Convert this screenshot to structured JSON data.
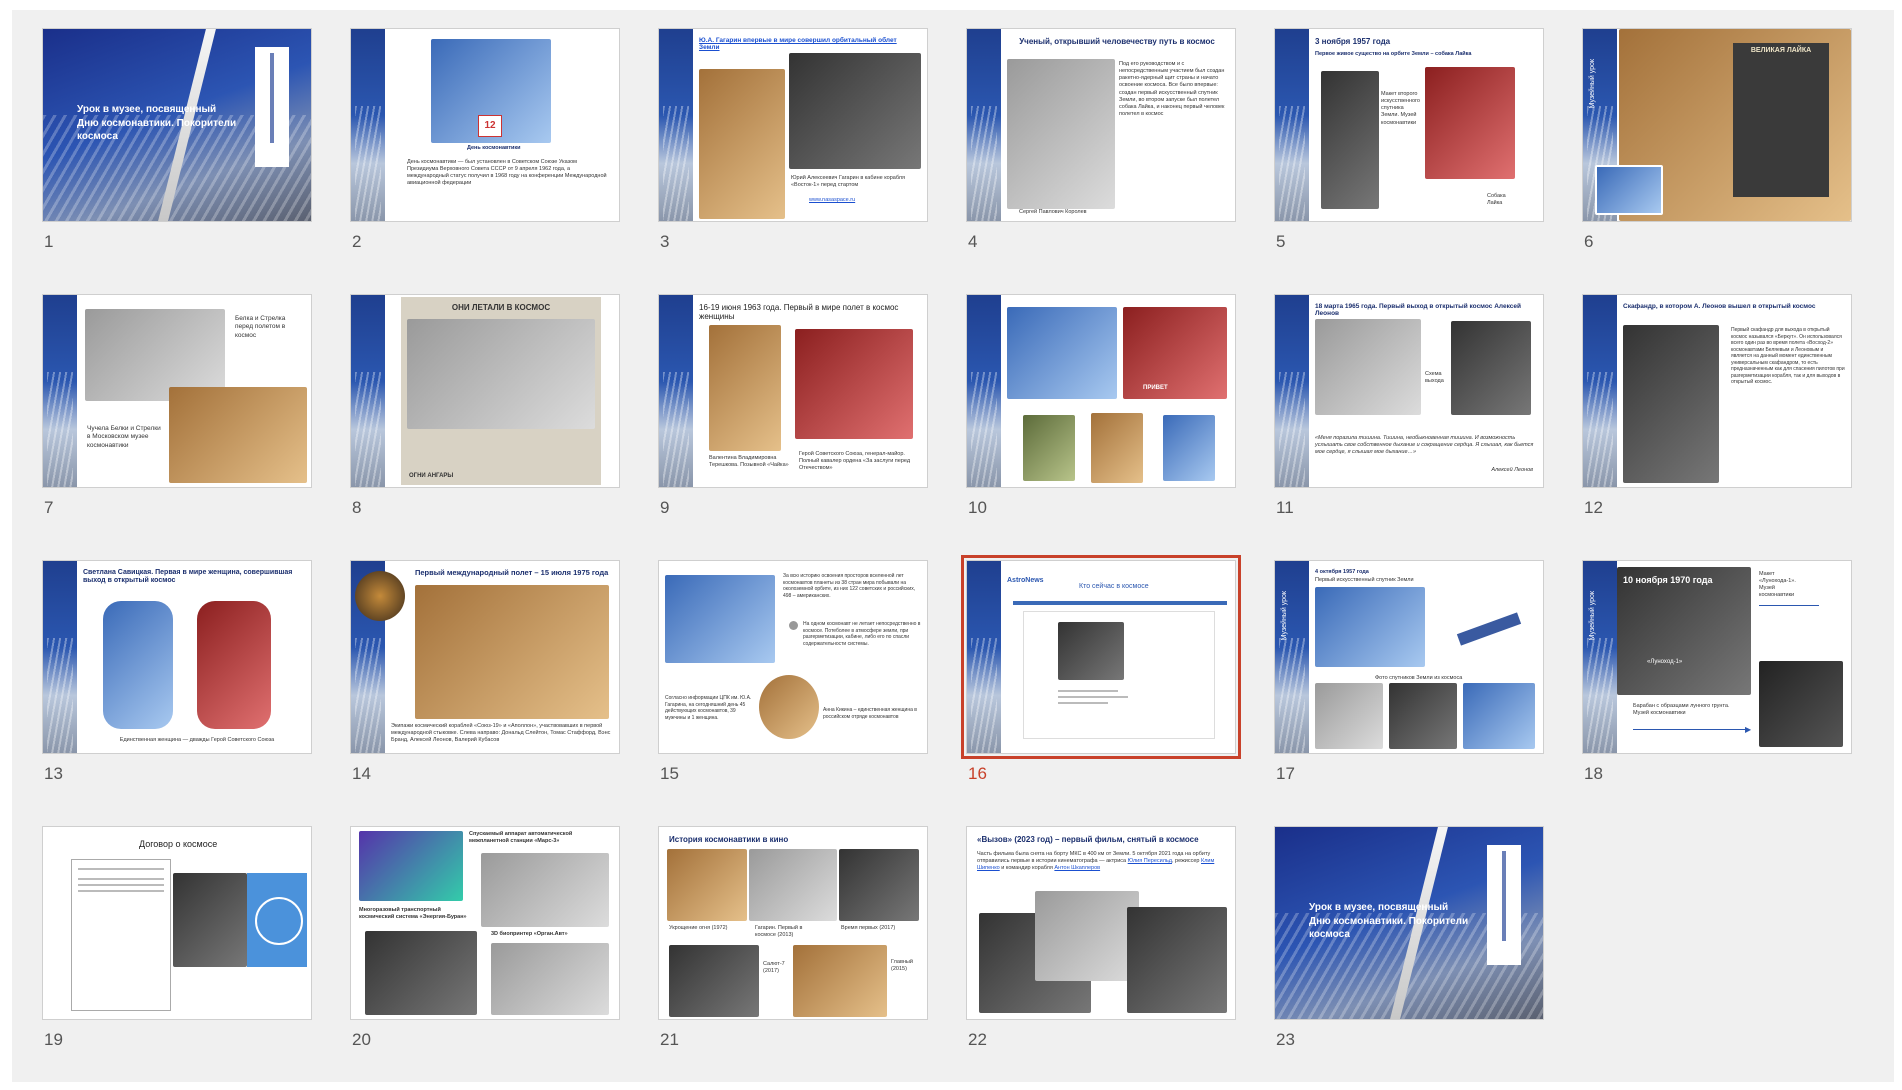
{
  "sorter": {
    "selected": "16",
    "slides": [
      {
        "n": "1",
        "title": "Урок в музее, посвященный Дню космонавтики. Покорители космоса"
      },
      {
        "n": "2",
        "text": "День космонавтики — был установлен в Советском Союзе Указом Президиума Верховного Совета СССР от 9 апреля 1962 года, а международный статус получил в 1968 году на конференции Международной авиационной федерации",
        "caption": "День космонавтики",
        "badge": "12"
      },
      {
        "n": "3",
        "title": "Ю.А. Гагарин впервые в мире совершил орбитальный облет Земли",
        "caption": "Юрий Алексеевич Гагарин в кабине корабля «Восток-1» перед стартом",
        "link": "www.nasaspace.ru"
      },
      {
        "n": "4",
        "title": "Ученый, открывший человечеству путь в космос",
        "text": "Под его руководством и с непосредственным участием был создан ракетно-ядерный щит страны и начато освоение космоса. Все было впервые: создан первый искусственный спутник Земли, во втором запуске был полетел собака Лайка, и наконец первый человек полетел в космос",
        "caption": "Сергей Павлович Королев"
      },
      {
        "n": "5",
        "title": "3 ноября 1957 года",
        "subtitle": "Первое живое существо на орбите Земли – собака Лайка",
        "text": "Макет второго искусственного спутника Земли. Музей космонавтики",
        "caption": "Собака Лайка"
      },
      {
        "n": "6",
        "plaque": "ВЕЛИКАЯ ЛАЙКА",
        "vertical": "Музейный урок"
      },
      {
        "n": "7",
        "text1": "Белка и Стрелка перед полетом в космос",
        "text2": "Чучела Белки и Стрелки в Московском музее космонавтики"
      },
      {
        "n": "8",
        "header": "ОНИ ЛЕТАЛИ В КОСМОС",
        "footer": "ОГНИ АНГАРЫ"
      },
      {
        "n": "9",
        "title": "16-19 июня 1963 года. Первый в мире полет в космос женщины",
        "caption1": "Валентина Владимировна Терешкова. Позывной «Чайка»",
        "caption2": "Герой Советского Союза, генерал-майор. Полный кавалер ордена «За заслуги перед Отечеством»"
      },
      {
        "n": "10",
        "stamp": "ПРИВЕТ"
      },
      {
        "n": "11",
        "title": "18 марта 1965 года. Первый выход в открытый космос Алексей Леонов",
        "quote": "«Меня поразила тишина. Тишина, необыкновенная тишина. И возможность услышать свое собственное дыхание и сокращение сердца. Я слышал, как бьется мое сердце, я слышал мое дыхание…»",
        "author": "Алексей Леонов",
        "small": "Схема выхода"
      },
      {
        "n": "12",
        "title": "Скафандр, в котором А. Леонов вышел в открытый космос",
        "text": "Первый скафандр для выхода в открытый космос назывался «Беркут». Он использовался всего один раз во время полета «Восход-2» космонавтами Беляевым и Леоновым и является на данный момент единственным универсальным скафандром, то есть предназначенным как для спасения пилотов при разгерметизации корабля, так и для выходов в открытый космос."
      },
      {
        "n": "13",
        "title": "Светлана Савицкая. Первая в мире женщина, совершившая выход в открытый космос",
        "caption": "Единственная женщина — дважды Герой Советского Союза"
      },
      {
        "n": "14",
        "title": "Первый международный полет – 15 июля 1975 года",
        "caption": "Экипажи космический кораблей «Союз-19» и «Аполлон», участвовавших в первой международной стыковке. Слева направо: Дональд Слейтон, Томас Стаффорд, Вэнс Бранд, Алексей Леонов, Валерий Кубасов"
      },
      {
        "n": "15",
        "text1": "За всю историю освоения просторов вселенной лет космонавтов планеты из 38 стран мира побывали на околоземной орбите, из них 122 советских и российских, 498 – американских.",
        "text2": "На одном космонавт не летает непосредственно в космосе. Потеболее в атмосфере земли, при разгерметизации, кабине, либо его по спасли содержательности системы.",
        "text3": "Согласно информации ЦПК им. Ю.А. Гагарина, на сегодняшний день 45 действующих космонавтов, 39 мужчины и 1 женщина.",
        "text4": "Анна Кикина – единственная женщина в российском отряде космонавтов"
      },
      {
        "n": "16",
        "brand": "AstroNews",
        "title": "Кто сейчас в космосе"
      },
      {
        "n": "17",
        "title": "4 октября 1957 года",
        "subtitle": "Первый искусственный спутник Земли",
        "caption": "Фото спутников Земли из космоса",
        "vertical": "Музейный урок"
      },
      {
        "n": "18",
        "title": "10 ноября 1970 года",
        "text": "Макет «Лунохода-1». Музей космонавтики",
        "caption": "Барабан с образцами лунного грунта. Музей космонавтики",
        "label": "«Луноход-1»",
        "vertical": "Музейный урок"
      },
      {
        "n": "19",
        "title": "Договор о космосе"
      },
      {
        "n": "20",
        "text1": "Спускаемый аппарат автоматической межпланетной станции «Марс-3»",
        "text2": "Многоразовый транспортный космический система «Энергия-Буран»",
        "text3": "3D биопринтер «Орган.Авт»"
      },
      {
        "n": "21",
        "title": "История космонавтики в кино",
        "c1": "Укрощение огня (1972)",
        "c2": "Гагарин. Первый в космосе (2013)",
        "c3": "Время первых (2017)",
        "c4": "Салют-7 (2017)",
        "c5": "Главный (2015)"
      },
      {
        "n": "22",
        "title": "«Вызов» (2023 год) – первый фильм, снятый в космосе",
        "text": "Часть фильма была снята на борту МКС в 400 км от Земли. 5 октября 2021 года на орбиту отправились первые в истории кинематографа — актриса",
        "link1": "Юлия Пересильд",
        "mid": ", режиссер",
        "link2": "Клим Шипенко",
        "end": "и командир корабля",
        "link3": "Антон Шкаплеров"
      },
      {
        "n": "23",
        "title": "Урок в музее, посвященный Дню космонавтики. Покорители космоса"
      }
    ]
  }
}
